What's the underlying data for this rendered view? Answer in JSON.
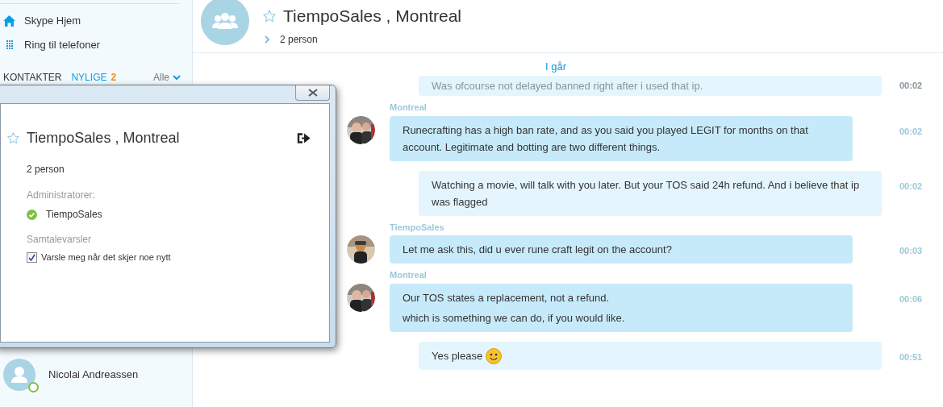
{
  "sidebar": {
    "nav": [
      {
        "kind": "home",
        "label": "Skype Hjem"
      },
      {
        "kind": "dialpad",
        "label": "Ring til telefoner"
      }
    ],
    "tabs": [
      {
        "label": "KONTAKTER",
        "selected": false
      },
      {
        "label": "NYLIGE",
        "selected": true,
        "count": "2"
      }
    ],
    "filter": "Alle",
    "contacts": [
      {
        "name": "Nicolai Andreassen",
        "online": true
      }
    ]
  },
  "conversation": {
    "title": "TiempoSales , Montreal",
    "members": "2 person",
    "date": "I går",
    "messages": [
      {
        "kind": "faded",
        "text": [
          "Was ofcourse not delayed banned right after i used that ip."
        ],
        "time": "00:02"
      },
      {
        "kind": "incoming",
        "sender": "Montreal",
        "text": [
          "Runecrafting has a high ban rate, and as you said you played LEGIT for months on that account. Legitimate and botting are two different things."
        ],
        "time": "00:02"
      },
      {
        "kind": "outgoing",
        "text": [
          "Watching a movie, will talk with you later. But your TOS said 24h refund. And i believe that ip was flagged"
        ],
        "time": "00:02"
      },
      {
        "kind": "incoming",
        "sender": "TiempoSales",
        "text": [
          "Let me ask this, did u ever rune craft legit on the account?"
        ],
        "time": "00:03"
      },
      {
        "kind": "incoming",
        "sender": "Montreal",
        "text": [
          "Our TOS states a replacement, not a refund.",
          "which is something we can do, if you would like."
        ],
        "time": "00:06"
      },
      {
        "kind": "outgoing",
        "text": [
          "Yes please"
        ],
        "emoji": true,
        "time": "00:51"
      }
    ]
  },
  "dialog": {
    "title": "TiempoSales , Montreal",
    "members": "2 person",
    "admins_label": "Administratorer:",
    "admins": [
      "TiempoSales"
    ],
    "alerts_label": "Samtalevarsler",
    "alert_option": {
      "label": "Varsle meg når det skjer noe nytt",
      "checked": true
    }
  }
}
